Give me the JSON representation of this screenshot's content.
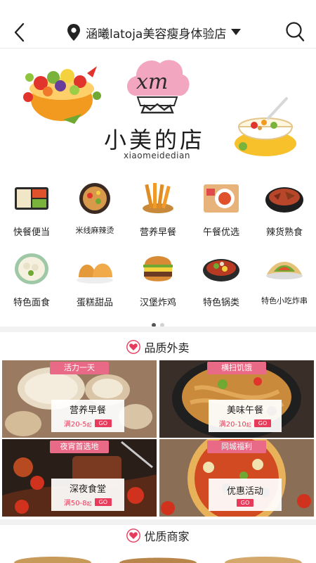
{
  "header": {
    "store_name": "涵曦latoja美容瘦身体验店"
  },
  "banner": {
    "logo_text": "小美的店",
    "logo_sub": "xiaomeidedian",
    "logo_mark": "xm"
  },
  "categories": [
    {
      "label": "快餐便当",
      "icon": "bento-icon"
    },
    {
      "label": "米线麻辣烫",
      "icon": "noodle-pot-icon"
    },
    {
      "label": "营养早餐",
      "icon": "fries-icon"
    },
    {
      "label": "午餐优选",
      "icon": "lunch-plate-icon"
    },
    {
      "label": "辣货熟食",
      "icon": "spicy-bowl-icon"
    },
    {
      "label": "特色面食",
      "icon": "dumplings-icon"
    },
    {
      "label": "蛋糕甜品",
      "icon": "bread-icon"
    },
    {
      "label": "汉堡炸鸡",
      "icon": "burger-icon"
    },
    {
      "label": "特色锅类",
      "icon": "hotpot-icon"
    },
    {
      "label": "特色小吃炸串",
      "icon": "wrap-icon"
    }
  ],
  "pager": {
    "count": 2,
    "active": 0
  },
  "sections": {
    "quality_takeout": "品质外卖",
    "quality_merchants": "优质商家"
  },
  "promos": [
    {
      "tag": "活力一天",
      "name": "营养早餐",
      "deal": "满20-5",
      "deal_suffix": "起",
      "go": "GO"
    },
    {
      "tag": "横扫饥饿",
      "name": "美味午餐",
      "deal": "满20-10",
      "deal_suffix": "起",
      "go": "GO"
    },
    {
      "tag": "夜宵首选地",
      "name": "深夜食堂",
      "deal": "满50-8",
      "deal_suffix": "起",
      "go": "GO"
    },
    {
      "tag": "同城福利",
      "name": "优惠活动",
      "deal": "",
      "deal_suffix": "",
      "go": "GO"
    }
  ],
  "colors": {
    "accent": "#e83b5b",
    "tag_pink": "#e86a86",
    "divider": "#f2f2f2"
  }
}
